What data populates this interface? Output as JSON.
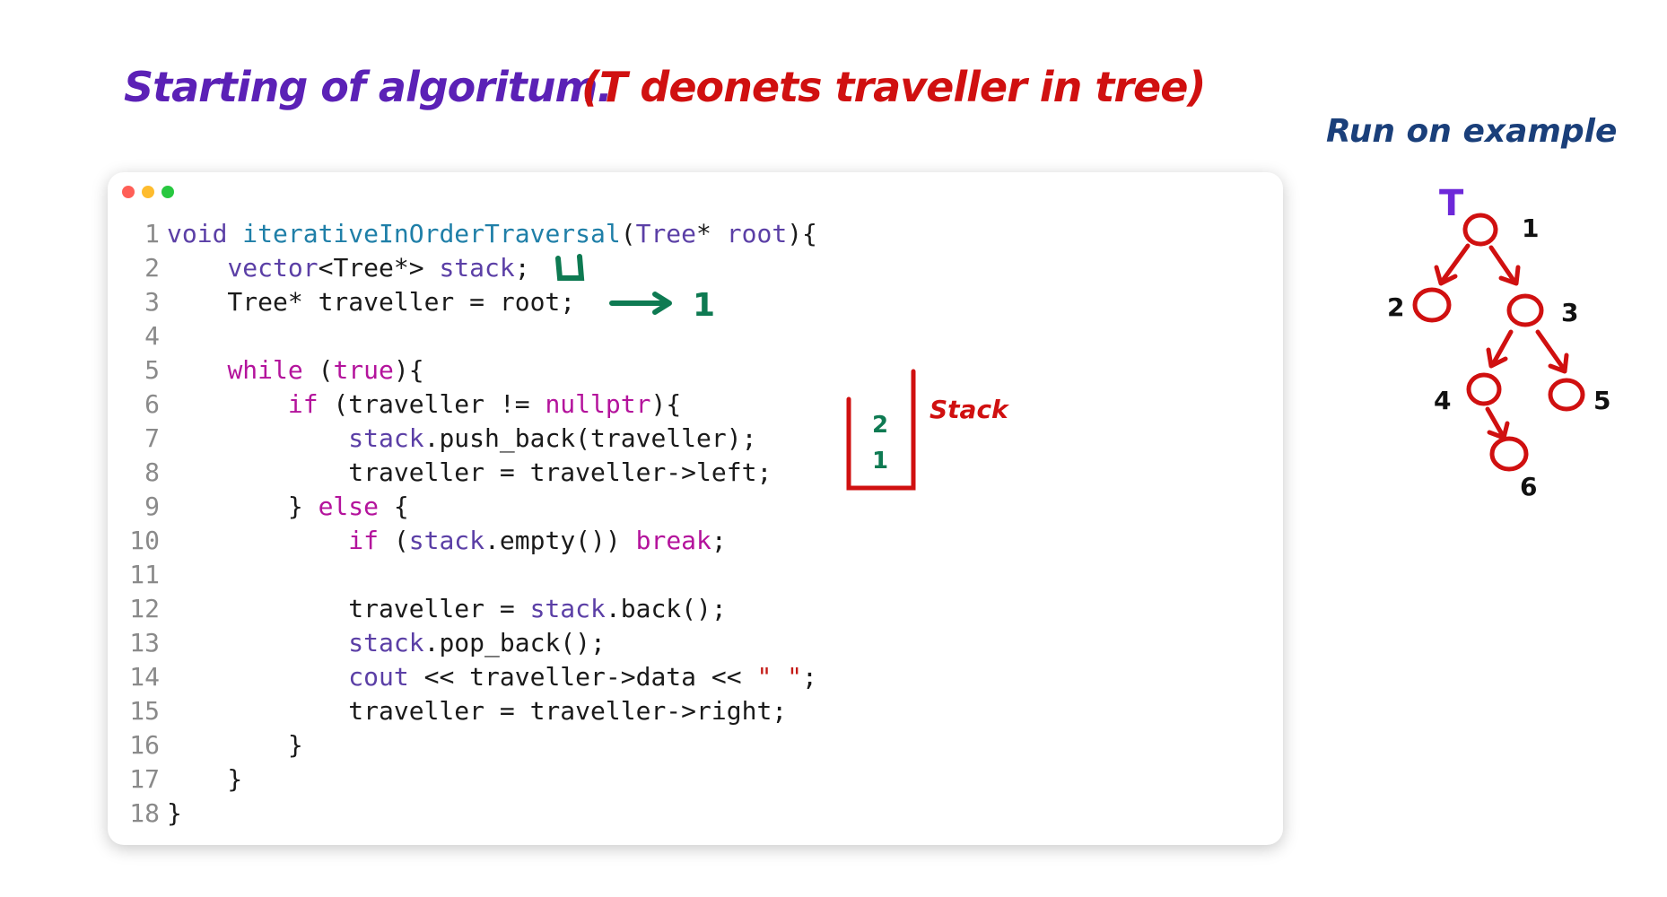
{
  "annotations": {
    "title_purple": "Starting of algoritum.",
    "title_red": "(T deonets traveller in tree)",
    "run_example": "Run on example",
    "stack_word": "Stack",
    "stack_items": [
      "2",
      "1"
    ],
    "traveller_value": "1",
    "tree_marker": "T"
  },
  "colors": {
    "purple": "#5b21b6",
    "red": "#d01010",
    "green": "#0e7a52",
    "navy": "#1a3f7a",
    "window_dots": [
      "#ff5f57",
      "#febc2e",
      "#28c840"
    ]
  },
  "tree": {
    "nodes": [
      "1",
      "2",
      "3",
      "4",
      "5",
      "6"
    ]
  },
  "code": {
    "line_numbers": [
      "1",
      "2",
      "3",
      "4",
      "5",
      "6",
      "7",
      "8",
      "9",
      "10",
      "11",
      "12",
      "13",
      "14",
      "15",
      "16",
      "17",
      "18"
    ],
    "tokens": [
      [
        [
          "ty",
          "void"
        ],
        [
          "",
          ""
        ],
        [
          "fn",
          " iterativeInOrderTraversal"
        ],
        [
          "",
          "("
        ],
        [
          "ty",
          "Tree"
        ],
        [
          "",
          "* "
        ],
        [
          "ty",
          "root"
        ],
        [
          "",
          ""
        ],
        [
          "",
          "){"
        ]
      ],
      [
        [
          "",
          "    "
        ],
        [
          "ty",
          "vector"
        ],
        [
          "",
          "<Tree*> "
        ],
        [
          "ty",
          "stack"
        ],
        [
          "",
          ";"
        ]
      ],
      [
        [
          "",
          "    Tree* traveller = root;"
        ]
      ],
      [
        [
          "",
          ""
        ]
      ],
      [
        [
          "",
          "    "
        ],
        [
          "kw",
          "while"
        ],
        [
          "",
          " ("
        ],
        [
          "kw",
          "true"
        ],
        [
          "",
          "){"
        ]
      ],
      [
        [
          "",
          "        "
        ],
        [
          "kw",
          "if"
        ],
        [
          "",
          " (traveller != "
        ],
        [
          "kw",
          "nullptr"
        ],
        [
          "",
          "){"
        ]
      ],
      [
        [
          "",
          "            "
        ],
        [
          "ty",
          "stack"
        ],
        [
          "",
          ".push_back(traveller);"
        ]
      ],
      [
        [
          "",
          "            traveller = traveller->left;"
        ]
      ],
      [
        [
          "",
          "        } "
        ],
        [
          "kw",
          "else"
        ],
        [
          "",
          " {"
        ]
      ],
      [
        [
          "",
          "            "
        ],
        [
          "kw",
          "if"
        ],
        [
          "",
          " ("
        ],
        [
          "ty",
          "stack"
        ],
        [
          "",
          ".empty()) "
        ],
        [
          "kw",
          "break"
        ],
        [
          "",
          ";"
        ]
      ],
      [
        [
          "",
          ""
        ]
      ],
      [
        [
          "",
          "            traveller = "
        ],
        [
          "ty",
          "stack"
        ],
        [
          "",
          ".back();"
        ]
      ],
      [
        [
          "",
          "            "
        ],
        [
          "ty",
          "stack"
        ],
        [
          "",
          ".pop_back();"
        ]
      ],
      [
        [
          "",
          "            "
        ],
        [
          "ty",
          "cout"
        ],
        [
          "",
          " << traveller->data << "
        ],
        [
          "str",
          "\" \""
        ],
        [
          "",
          ";"
        ]
      ],
      [
        [
          "",
          "            traveller = traveller->right;"
        ]
      ],
      [
        [
          "",
          "        }"
        ]
      ],
      [
        [
          "",
          "    }"
        ]
      ],
      [
        [
          "",
          "}"
        ]
      ]
    ]
  }
}
